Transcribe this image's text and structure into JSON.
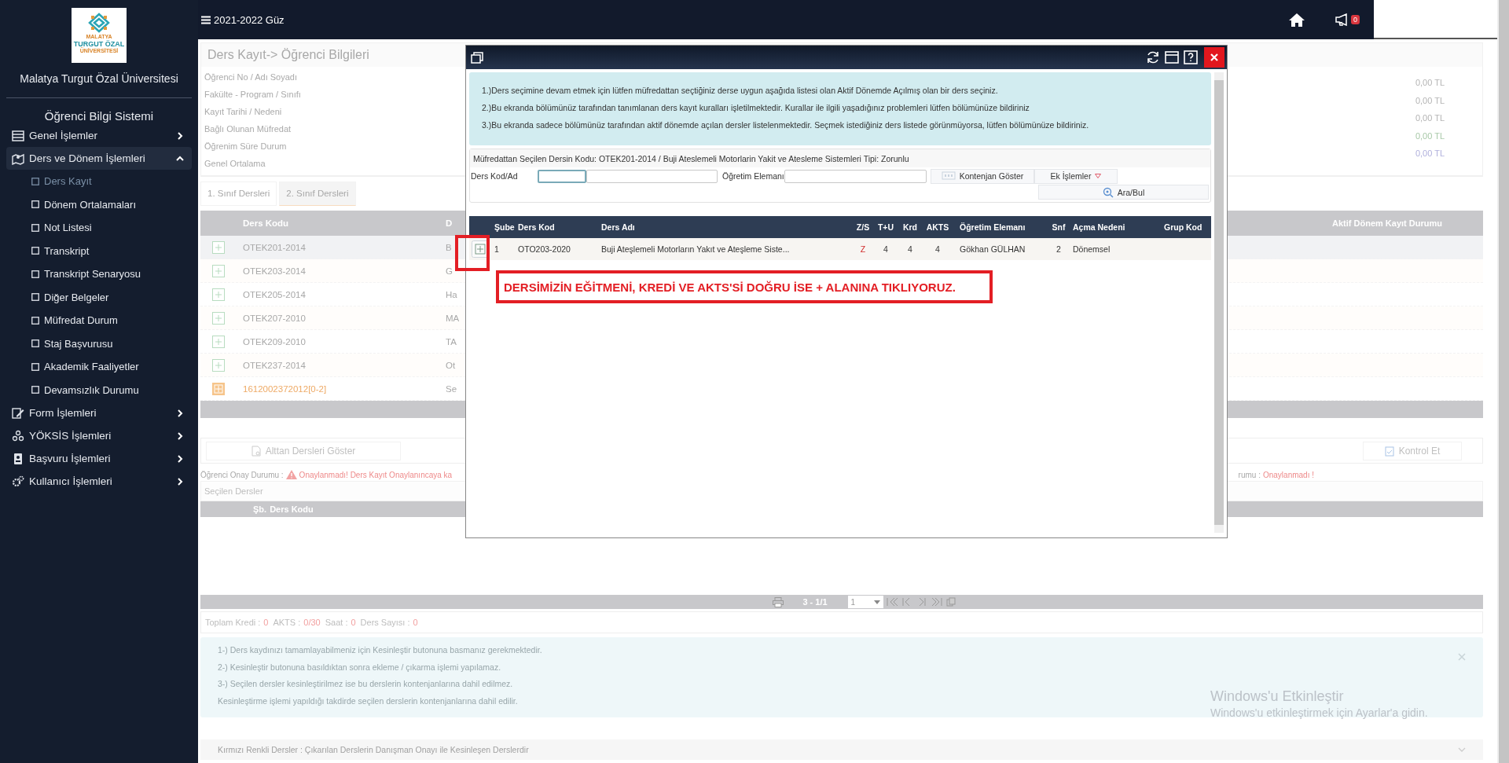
{
  "sidebar": {
    "logo_text": [
      "MALATYA",
      "TURGUT ÖZAL",
      "ÜNİVERSİTESİ"
    ],
    "university": "Malatya Turgut Özal Üniversitesi",
    "system": "Öğrenci Bilgi Sistemi",
    "menu": [
      {
        "label": "Genel İşlemler",
        "expanded": false
      },
      {
        "label": "Ders ve Dönem İşlemleri",
        "expanded": true,
        "children": [
          {
            "label": "Ders Kayıt",
            "selected": true
          },
          {
            "label": "Dönem Ortalamaları",
            "selected": false
          },
          {
            "label": "Not Listesi",
            "selected": false
          },
          {
            "label": "Transkript",
            "selected": false
          },
          {
            "label": "Transkript Senaryosu",
            "selected": false
          },
          {
            "label": "Diğer Belgeler",
            "selected": false
          },
          {
            "label": "Müfredat Durum",
            "selected": false
          },
          {
            "label": "Staj Başvurusu",
            "selected": false
          },
          {
            "label": "Akademik Faaliyetler",
            "selected": false
          },
          {
            "label": "Devamsızlık Durumu",
            "selected": false
          }
        ]
      },
      {
        "label": "Form İşlemleri",
        "expanded": false
      },
      {
        "label": "YÖKSİS İşlemleri",
        "expanded": false
      },
      {
        "label": "Başvuru İşlemleri",
        "expanded": false
      },
      {
        "label": "Kullanıcı İşlemleri",
        "expanded": false
      }
    ]
  },
  "topbar": {
    "term": "2021-2022 Güz",
    "notifications": "0"
  },
  "student_card": {
    "title": "Ders Kayıt->  Öğrenci Bilgileri",
    "labels": [
      "Öğrenci No / Adı Soyadı",
      "Fakülte - Program / Sınıfı",
      "Kayıt Tarihi / Nedeni",
      "Bağlı Olunan Müfredat",
      "Öğrenim Süre Durum",
      "Genel Ortalama"
    ],
    "fees": [
      {
        "value": "0,00 TL",
        "color": "#b4b4b4"
      },
      {
        "value": "0,00 TL",
        "color": "#b4b4b4"
      },
      {
        "value": "0,00 TL",
        "color": "#b4b4b4"
      },
      {
        "value": "0,00 TL",
        "color": "#a9c9a9"
      },
      {
        "value": "0,00 TL",
        "color": "#b0b0dc"
      }
    ]
  },
  "tabs": [
    {
      "label": "1. Sınıf Dersleri",
      "selected": false
    },
    {
      "label": "2. Sınıf Dersleri",
      "selected": true
    }
  ],
  "courses_table": {
    "columns": [
      "Ders Kodu",
      "D",
      "Aktif Dönem Kayıt Durumu"
    ],
    "rows": [
      {
        "kind": "course",
        "selected": true,
        "cells": [
          "OTEK201-2014",
          "B"
        ]
      },
      {
        "kind": "course",
        "selected": false,
        "cells": [
          "OTEK203-2014",
          "G"
        ]
      },
      {
        "kind": "course",
        "selected": false,
        "cells": [
          "OTEK205-2014",
          "Ha"
        ]
      },
      {
        "kind": "course",
        "selected": false,
        "cells": [
          "OTEK207-2010",
          "MA"
        ]
      },
      {
        "kind": "course",
        "selected": false,
        "cells": [
          "OTEK209-2010",
          "TA"
        ]
      },
      {
        "kind": "course",
        "selected": false,
        "cells": [
          "OTEK237-2014",
          "Ot"
        ]
      },
      {
        "kind": "elective",
        "selected": false,
        "cells": [
          "1612002372012[0-2]",
          "Se"
        ]
      }
    ]
  },
  "actions": [
    "Alttan Dersleri Göster",
    "Kontrol Et"
  ],
  "approval": {
    "label": "Öğrenci Onay Durumu :",
    "status": "Onaylanmadı! Ders Kayıt Onaylanıncaya ka",
    "label_2": "rumu :",
    "status_2": "Onaylanmadı !"
  },
  "selected_courses": {
    "title": "Seçilen Dersler",
    "columns": [
      "Şb.",
      "Ders Kodu"
    ]
  },
  "pager": {
    "info": "3 - 1/1",
    "page": "1"
  },
  "totals": [
    {
      "label": "Toplam Kredi :",
      "value": "0"
    },
    {
      "label": "AKTS :",
      "value": "0/30"
    },
    {
      "label": "Saat :",
      "value": "0"
    },
    {
      "label": "Ders Sayısı :",
      "value": "0"
    }
  ],
  "notes": [
    "1-) Ders kaydınızı tamamlayabilmeniz için Kesinleştir butonuna basmanız gerekmektedir.",
    "2-) Kesinleştir butonuna basıldıktan sonra ekleme / çıkarma işlemi yapılamaz.",
    "3-) Seçilen dersler kesinleştirilmez ise bu derslerin kontenjanlarına dahil edilmez.",
    "Kesinleştirme işlemi yapıldığı takdirde seçilen derslerin kontenjanlarına dahil edilir."
  ],
  "footer_note": "Kırmızı Renkli Dersler : Çıkarılan Derslerin Danışman Onayı ile Kesinleşen Derslerdir",
  "os_notice": {
    "title": "Windows'u Etkinleştir",
    "text": "Windows'u etkinleştirmek için Ayarlar'a gidin."
  },
  "modal": {
    "notes": [
      "1.)Ders seçimine devam etmek için lütfen müfredattan seçtiğiniz derse uygun aşağıda listesi olan Aktif Dönemde Açılmış olan bir ders seçiniz.",
      "2.)Bu ekranda bölümünüz tarafından tanımlanan ders kayıt kuralları işletilmektedir. Kurallar ile ilgili yaşadığınız problemleri lütfen bölümünüze bildiriniz",
      "3.)Bu ekranda sadece bölümünüz tarafından aktif dönemde açılan dersler listelenmektedir. Seçmek istediğiniz ders listede görünmüyorsa, lütfen bölümünüze bildiriniz."
    ],
    "selected_course": "Müfredattan Seçilen Dersin Kodu: OTEK201-2014 / Buji Ateslemeli Motorlarin Yakit ve Atesleme Sistemleri Tipi: Zorunlu",
    "filter_labels": [
      "Ders Kod/Ad",
      "Öğretim Elemanı"
    ],
    "buttons": [
      "Kontenjan Göster",
      "Ek İşlemler",
      "Ara/Bul"
    ],
    "columns": [
      "Şube",
      "Ders Kod",
      "Ders Adı",
      "Z/S",
      "T+U",
      "Krd",
      "AKTS",
      "Öğretim Elemanı",
      "Snf",
      "Açma Nedeni",
      "Grup Kod"
    ],
    "rows": [
      {
        "cells": [
          "1",
          "OTO203-2020",
          "Buji Ateşlemeli Motorların Yakıt ve Ateşleme Siste...",
          "Z",
          "4",
          "4",
          "4",
          "Gökhan GÜLHAN",
          "2",
          "Dönemsel"
        ]
      }
    ],
    "annotation": "DERSİMİZİN EĞİTMENİ, KREDİ VE AKTS'Sİ DOĞRU İSE + ALANINA TIKLIYORUZ."
  }
}
